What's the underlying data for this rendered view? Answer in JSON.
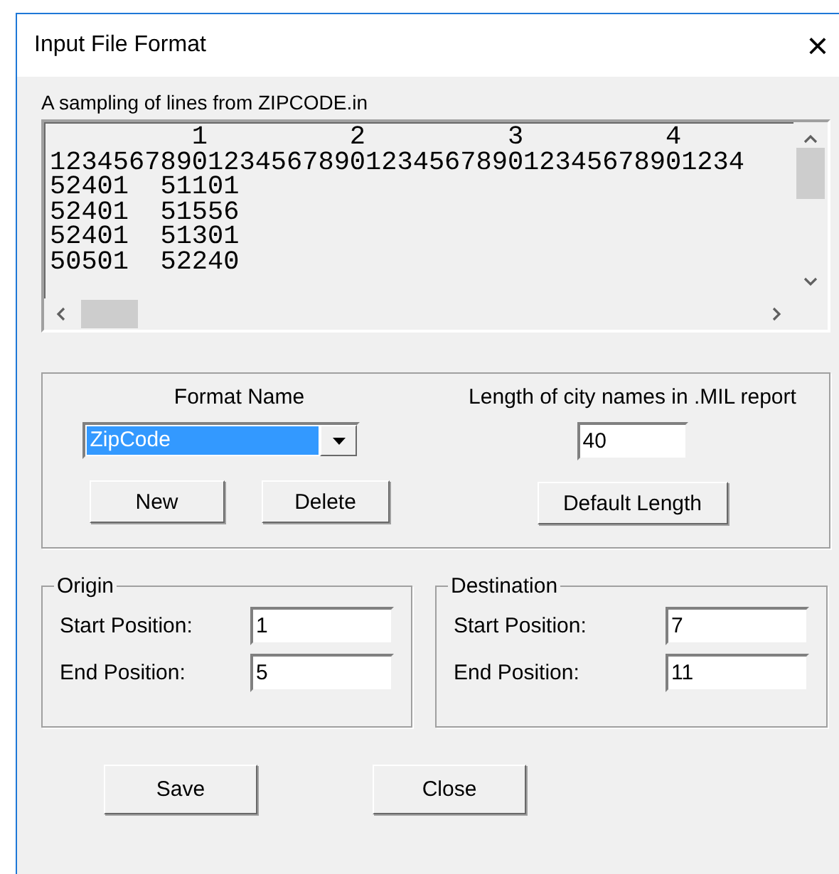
{
  "window": {
    "title": "Input File Format",
    "close": "×"
  },
  "sample": {
    "label": "A sampling of lines from ZIPCODE.in",
    "lines": [
      "         1         2         3         4",
      "12345678901234567890123456789012345678901234",
      "52401  51101",
      "52401  51556",
      "52401  51301",
      "50501  52240"
    ]
  },
  "format": {
    "label": "Format Name",
    "value": "ZipCode",
    "highlighted": true,
    "buttons": [
      "New",
      "Delete"
    ]
  },
  "city_length": {
    "label": "Length of city names in .MIL report",
    "value": "40",
    "button": "Default Length"
  },
  "groups": [
    {
      "title": "Origin",
      "fields": [
        {
          "label": "Start Position:",
          "value": "1"
        },
        {
          "label": "End Position:",
          "value": "5"
        }
      ]
    },
    {
      "title": "Destination",
      "fields": [
        {
          "label": "Start Position:",
          "value": "7"
        },
        {
          "label": "End Position:",
          "value": "11"
        }
      ]
    }
  ],
  "buttons": [
    "Save",
    "Close"
  ]
}
